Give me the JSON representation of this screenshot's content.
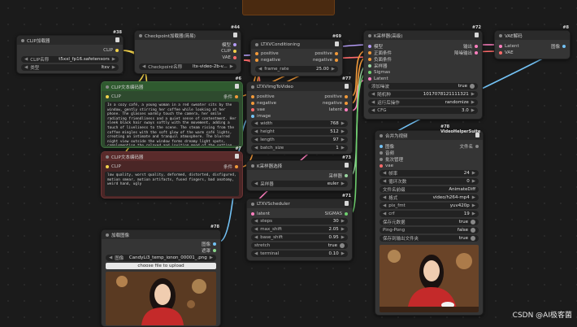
{
  "colors": {
    "clip": "#f2d24b",
    "model": "#b49cf5",
    "conditioning": "#f29a3a",
    "latent": "#ff7fbf",
    "vae": "#ff6b6b",
    "image": "#73c2f5",
    "int": "#6fd16f"
  },
  "nodes": {
    "clip_loader": {
      "badge": "#38",
      "title": "CLIP加载器",
      "out_clip": "CLIP",
      "w1_label": "CLIP名称",
      "w1_value": "t5xxl_fp16.safetensors",
      "w2_label": "类型",
      "w2_value": "ltxv"
    },
    "checkpoint": {
      "badge": "#44",
      "title": "Checkpoint加载器(简易)",
      "out1": "模型",
      "out2": "CLIP",
      "out3": "VAE",
      "w1_label": "Checkpoint名称",
      "w1_value": "ltx-video-2b-v..."
    },
    "ltxv_cond": {
      "badge": "#69",
      "title": "LTXVConditioning",
      "in1": "positive",
      "in2": "negative",
      "out1": "positive",
      "out2": "negative",
      "w1_label": "frame_rate",
      "w1_value": "25.00"
    },
    "ksampler": {
      "badge": "#72",
      "title": "K采样器(高级)",
      "header_extra": "11.1002",
      "in": [
        "模型",
        "正面条件",
        "负面条件",
        "采样器",
        "Sigmas",
        "Latent"
      ],
      "out1": "输出",
      "out2": "降噪输出",
      "w1_label": "添加噪波",
      "w1_value": "true",
      "w2_label": "随机种",
      "w2_value": "1017078121111321",
      "w3_label": "运行后操作",
      "w3_value": "randomize",
      "w4_label": "CFG",
      "w4_value": "3.0"
    },
    "vae_decode": {
      "badge": "#8",
      "title": "VAE解码",
      "header_extra": "1.6198",
      "in1": "Latent",
      "in2": "VAE",
      "out1": "图像"
    },
    "clip_pos": {
      "badge": "#6",
      "title": "CLIP文本编码器",
      "in_clip": "CLIP",
      "out": "条件",
      "text": "In a cozy café, a young woman in a red sweater sits by the window, gently stirring her coffee while looking at her phone. The glasses warmly touch the camera, her smile radiating friendliness and a quiet sense of contentment. Her sleek black hair sways softly with the movement, adding a touch of liveliness to the scene. The steam rising from the coffee mingles with the soft glow of the warm café lights, creating an intimate and tranquil atmosphere. The blurred night view outside the window forms dreamy light spots, complementing the relaxed and inviting mood of the setting, as if time has slowed for this serene moment."
    },
    "clip_neg": {
      "badge": "#7",
      "title": "CLIP文本编码器",
      "in_clip": "CLIP",
      "out": "条件",
      "text": "low quality, worst quality, deformed, distorted, disfigured, motion smear, motion artifacts, fused fingers, bad anatomy, weird hand, ugly"
    },
    "ltxv_img2vid": {
      "badge": "#77",
      "title": "LTXVImgToVideo",
      "in": [
        "positive",
        "negative",
        "vae",
        "image"
      ],
      "out1": "positive",
      "out2": "negative",
      "out3": "latent",
      "w": [
        [
          "width",
          "768"
        ],
        [
          "height",
          "512"
        ],
        [
          "length",
          "97"
        ],
        [
          "batch_size",
          "1"
        ]
      ]
    },
    "sampler_select": {
      "badge": "#73",
      "title": "K采样器选择",
      "out": "采样器",
      "w1_label": "采样器",
      "w1_value": "euler"
    },
    "scheduler": {
      "badge": "#71",
      "title": "LTXVScheduler",
      "in": "latent",
      "out": "SIGMAS",
      "w": [
        [
          "steps",
          "30"
        ],
        [
          "max_shift",
          "2.05"
        ],
        [
          "base_shift",
          "0.95"
        ],
        [
          "stretch",
          "true"
        ],
        [
          "terminal",
          "0.10"
        ]
      ]
    },
    "load_image": {
      "badge": "#78",
      "title": "加载图像",
      "out1": "图像",
      "out2": "遮罩",
      "w1_label": "图像",
      "w1_value": "CandyLi3_temp_ionon_00001_.png",
      "upload": "choose file to upload"
    },
    "video_combine": {
      "badge": "#78 VideoHelperSuite",
      "title": "合并为视频",
      "header_extra": "11.1080",
      "in": [
        "图像",
        "音频",
        "批次管理",
        "vae"
      ],
      "out": "文件名",
      "w": [
        [
          "帧率",
          "24"
        ],
        [
          "循环次数",
          "0"
        ],
        [
          "文件名前缀",
          "AnimateDiff"
        ],
        [
          "格式",
          "video/h264-mp4"
        ],
        [
          "pix_fmt",
          "yuv420p"
        ],
        [
          "crf",
          "19"
        ],
        [
          "保存元数据",
          "true"
        ],
        [
          "Ping-Pong",
          "false"
        ],
        [
          "保存到输出文件夹",
          "true"
        ]
      ]
    }
  },
  "watermark": "CSDN @AI极客菌"
}
